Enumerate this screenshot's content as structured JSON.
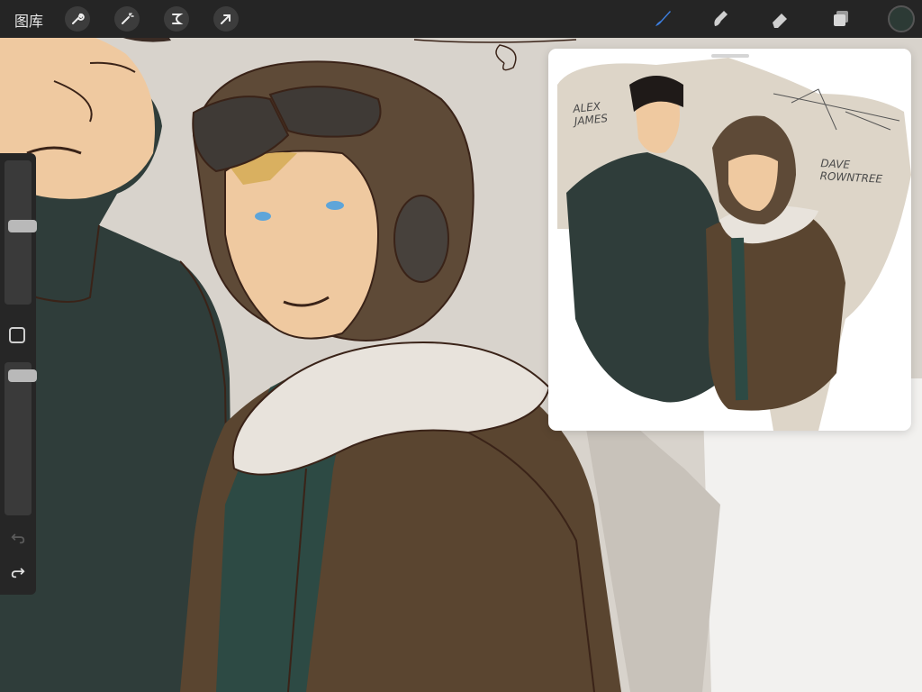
{
  "toolbar": {
    "gallery_label": "图库",
    "left_tools": [
      "wrench-icon",
      "magic-wand-icon",
      "selection-icon",
      "transform-arrow-icon"
    ],
    "right_tools": [
      "brush-icon",
      "smudge-icon",
      "eraser-icon",
      "layers-icon"
    ],
    "active_tool": "brush-icon",
    "current_color": "#2c3a35",
    "accent_color": "#3d7fe0"
  },
  "sidebar": {
    "brush_size_level": 0.55,
    "opacity_level": 0.05,
    "icons": [
      "modify-square-icon",
      "undo-icon",
      "redo-icon"
    ]
  },
  "reference": {
    "label_left": "ALEX\nJAMES",
    "label_right": "DAVE\nROWNTREE"
  },
  "colors": {
    "background": "#d8d3cc",
    "jacket_dark": "#2f3d3a",
    "jacket_brown": "#5a4530",
    "helmet": "#5e4a37",
    "skin": "#efc9a0",
    "fur": "#e8e3dc",
    "line": "#3a2318"
  }
}
